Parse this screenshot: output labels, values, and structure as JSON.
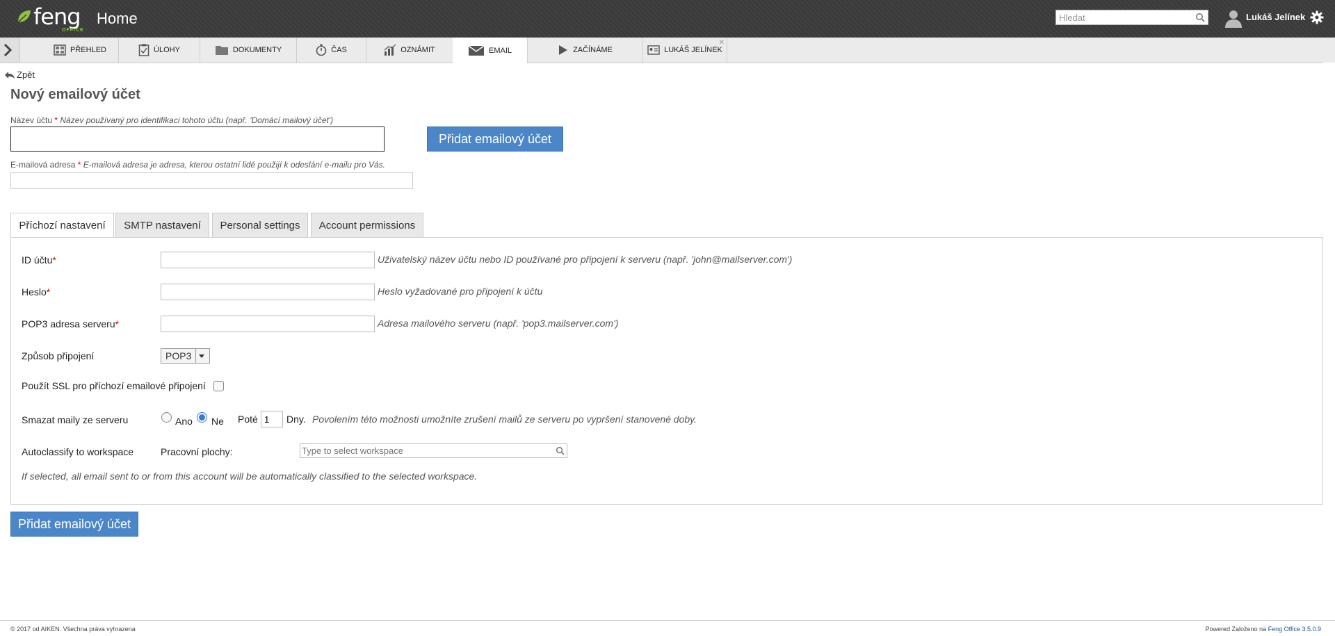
{
  "header": {
    "logo_text": "feng",
    "logo_sub": "OFFICE",
    "page_title": "Home",
    "search_placeholder": "Hledat",
    "user_name": "Lukáš Jelínek"
  },
  "tabs": [
    {
      "label": "PŘEHLED",
      "icon": "dashboard-icon"
    },
    {
      "label": "ÚLOHY",
      "icon": "tasks-icon"
    },
    {
      "label": "DOKUMENTY",
      "icon": "folder-icon"
    },
    {
      "label": "ČAS",
      "icon": "stopwatch-icon"
    },
    {
      "label": "OZNÁMIT",
      "icon": "chart-icon"
    },
    {
      "label": "EMAIL",
      "icon": "envelope-icon",
      "active": true
    },
    {
      "label": "ZAČÍNÁME",
      "icon": "play-icon"
    },
    {
      "label": "LUKÁŠ JELÍNEK",
      "icon": "contact-card-icon",
      "closable": true
    }
  ],
  "form": {
    "back_label": "Zpět",
    "title": "Nový emailový účet",
    "account_name": {
      "label": "Název účtu",
      "required": "*",
      "hint": "Název používaný pro identifikaci tohoto účtu (např. 'Domácí mailový účet')",
      "value": ""
    },
    "email": {
      "label": "E-mailová adresa",
      "required": "*",
      "hint": "E-mailová adresa je adresa, kterou ostatní lidé použijí k odeslání e-mailu pro Vás.",
      "value": ""
    },
    "submit_label": "Přidat emailový účet"
  },
  "subtabs": [
    {
      "label": "Příchozí nastavení",
      "active": true
    },
    {
      "label": "SMTP nastavení"
    },
    {
      "label": "Personal settings"
    },
    {
      "label": "Account permissions"
    }
  ],
  "incoming": {
    "account_id": {
      "label": "ID účtu",
      "required": "*",
      "hint": "Uživatelský název účtu nebo ID používané pro připojení k serveru (např. 'john@mailserver.com')",
      "value": ""
    },
    "password": {
      "label": "Heslo",
      "required": "*",
      "hint": "Heslo vyžadované pro připojení k účtu",
      "value": ""
    },
    "server": {
      "label": "POP3 adresa serveru",
      "required": "*",
      "hint": "Adresa mailového serveru (např. 'pop3.mailserver.com')",
      "value": ""
    },
    "method": {
      "label": "Způsob připojení",
      "value": "POP3"
    },
    "ssl": {
      "label": "Použít SSL pro příchozí emailové připojení",
      "checked": false
    },
    "delete": {
      "label": "Smazat maily ze serveru",
      "yes_label": "Ano",
      "no_label": "Ne",
      "selected": "Ne",
      "after_label": "Poté",
      "days_value": "1",
      "days_label": "Dny.",
      "hint": "Povolením této možnosti umožníte zrušení mailů ze serveru po vypršení stanovené doby."
    },
    "autoclassify": {
      "label": "Autoclassify to workspace",
      "workspace_label": "Pracovní plochy:",
      "placeholder": "Type to select workspace",
      "note": "If selected, all email sent to or from this account will be automatically classified to the selected workspace."
    }
  },
  "footer": {
    "copyright": "© 2017 od AIKEN. Všechna práva vyhrazena",
    "powered": "Powered Založeno na",
    "product": "Feng Office 3.5.0.9"
  },
  "colors": {
    "accent": "#4a86c8",
    "header_bg": "#3a3a3a",
    "required": "#cc0000"
  }
}
